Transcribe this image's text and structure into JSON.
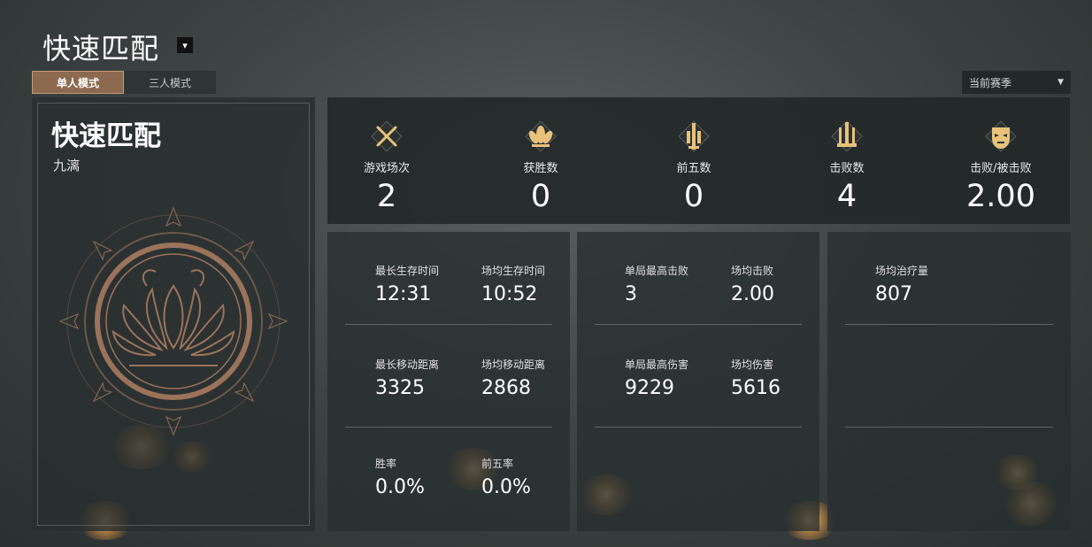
{
  "header": {
    "title": "快速匹配",
    "dropdown_glyph": "▾"
  },
  "mode_tabs": [
    {
      "label": "单人模式",
      "active": true
    },
    {
      "label": "三人模式",
      "active": false
    }
  ],
  "season_select": {
    "value": "当前赛季",
    "arrow": "▼"
  },
  "left_panel": {
    "mode_name": "快速匹配",
    "player_name": "九漓",
    "emblem_icon": "lotus-emblem-icon"
  },
  "summary": [
    {
      "icon": "crossed-swords-icon",
      "label": "游戏场次",
      "value": "2"
    },
    {
      "icon": "lotus-flower-icon",
      "label": "获胜数",
      "value": "0"
    },
    {
      "icon": "sword-banner-icon",
      "label": "前五数",
      "value": "0"
    },
    {
      "icon": "trident-icon",
      "label": "击败数",
      "value": "4"
    },
    {
      "icon": "demon-mask-icon",
      "label": "击败/被击败",
      "value": "2.00"
    }
  ],
  "cards": [
    {
      "stats": [
        {
          "label": "最长生存时间",
          "value": "12:31"
        },
        {
          "label": "场均生存时间",
          "value": "10:52"
        },
        {
          "label": "最长移动距离",
          "value": "3325"
        },
        {
          "label": "场均移动距离",
          "value": "2868"
        },
        {
          "label": "胜率",
          "value": "0.0%"
        },
        {
          "label": "前五率",
          "value": "0.0%"
        }
      ]
    },
    {
      "stats": [
        {
          "label": "单局最高击败",
          "value": "3"
        },
        {
          "label": "场均击败",
          "value": "2.00"
        },
        {
          "label": "单局最高伤害",
          "value": "9229"
        },
        {
          "label": "场均伤害",
          "value": "5616"
        }
      ]
    },
    {
      "stats": [
        {
          "label": "场均治疗量",
          "value": "807"
        }
      ]
    }
  ],
  "colors": {
    "accent": "#8c6a4f",
    "gold": "#e8c27a",
    "emblem": "#9a735a"
  }
}
